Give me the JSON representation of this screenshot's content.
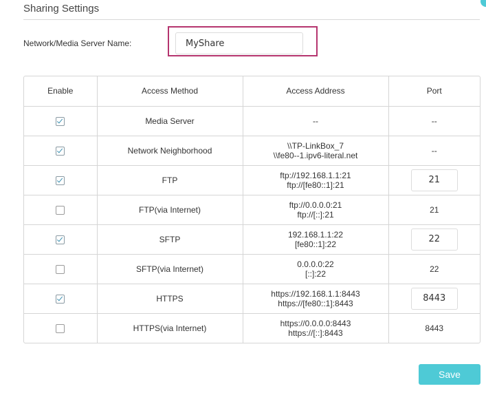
{
  "section": {
    "title": "Sharing Settings"
  },
  "server_name": {
    "label": "Network/Media Server Name:",
    "value": "MyShare"
  },
  "table": {
    "headers": {
      "enable": "Enable",
      "method": "Access Method",
      "address": "Access Address",
      "port": "Port"
    },
    "rows": [
      {
        "enabled": true,
        "method": "Media Server",
        "address": [
          "--"
        ],
        "port": "--",
        "port_editable": false
      },
      {
        "enabled": true,
        "method": "Network Neighborhood",
        "address": [
          "\\\\TP-LinkBox_7",
          "\\\\fe80--1.ipv6-literal.net"
        ],
        "port": "--",
        "port_editable": false
      },
      {
        "enabled": true,
        "method": "FTP",
        "address": [
          "ftp://192.168.1.1:21",
          "ftp://[fe80::1]:21"
        ],
        "port": "21",
        "port_editable": true
      },
      {
        "enabled": false,
        "method": "FTP(via Internet)",
        "address": [
          "ftp://0.0.0.0:21",
          "ftp://[::]:21"
        ],
        "port": "21",
        "port_editable": false
      },
      {
        "enabled": true,
        "method": "SFTP",
        "address": [
          "192.168.1.1:22",
          "[fe80::1]:22"
        ],
        "port": "22",
        "port_editable": true
      },
      {
        "enabled": false,
        "method": "SFTP(via Internet)",
        "address": [
          "0.0.0.0:22",
          "[::]:22"
        ],
        "port": "22",
        "port_editable": false
      },
      {
        "enabled": true,
        "method": "HTTPS",
        "address": [
          "https://192.168.1.1:8443",
          "https://[fe80::1]:8443"
        ],
        "port": "8443",
        "port_editable": true
      },
      {
        "enabled": false,
        "method": "HTTPS(via Internet)",
        "address": [
          "https://0.0.0.0:8443",
          "https://[::]:8443"
        ],
        "port": "8443",
        "port_editable": false
      }
    ]
  },
  "actions": {
    "save_label": "Save"
  },
  "colors": {
    "accent": "#4ecad6",
    "highlight": "#b5346e",
    "border": "#d5d5d5"
  }
}
